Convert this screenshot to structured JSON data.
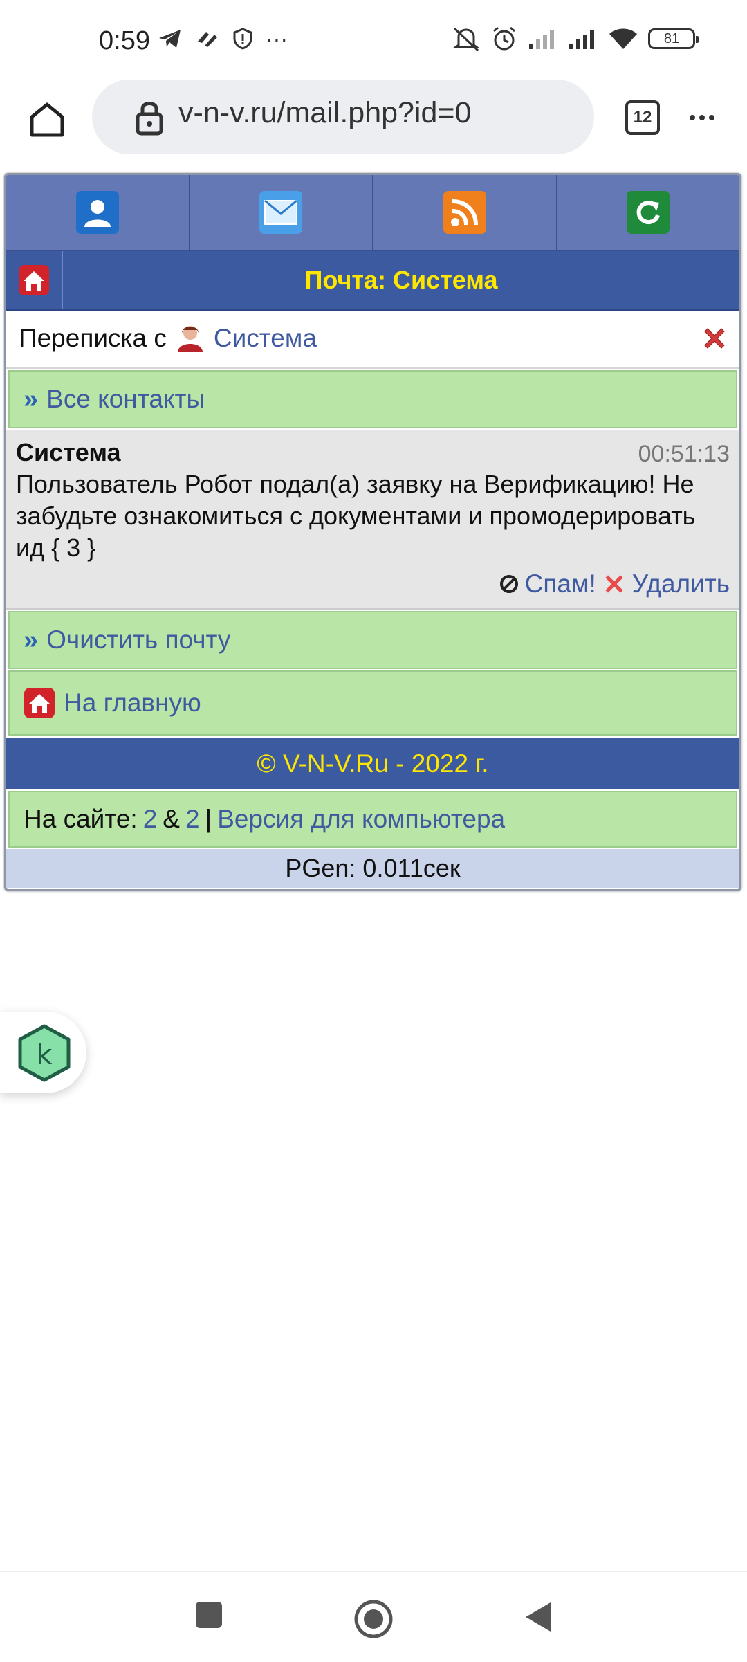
{
  "status_bar": {
    "time": "0:59",
    "battery": "81"
  },
  "browser": {
    "url": "v-n-v.ru/mail.php?id=0",
    "tab_count": "12",
    "menu_glyph": "⋮"
  },
  "site": {
    "header_title": "Почта: Система",
    "nav_icons": [
      "profile-icon",
      "mail-icon",
      "rss-icon",
      "refresh-icon"
    ],
    "conversation": {
      "prefix": "Переписка с",
      "contact": "Система"
    },
    "all_contacts": "Все контакты",
    "message": {
      "from": "Система",
      "time": "00:51:13",
      "body": "Пользователь Робот подал(а) заявку на Верификацию! Не забудьте ознакомиться с документами и промодерировать ид { 3 }",
      "spam": "Спам!",
      "delete": "Удалить"
    },
    "clear_mail": "Очистить почту",
    "home_link": "На главную",
    "copyright": "© V-N-V.Ru - 2022 г.",
    "online": {
      "label": "На сайте:",
      "count1": "2",
      "amp": "&",
      "count2": "2",
      "sep": "|",
      "desktop_link": "Версия для компьютера"
    },
    "pgen": "PGen: 0.011сек"
  },
  "colors": {
    "header_blue": "#3b5aa0",
    "title_yellow": "#ffe600",
    "row_green": "#b9e6a7",
    "link_blue": "#3f5aa0"
  }
}
